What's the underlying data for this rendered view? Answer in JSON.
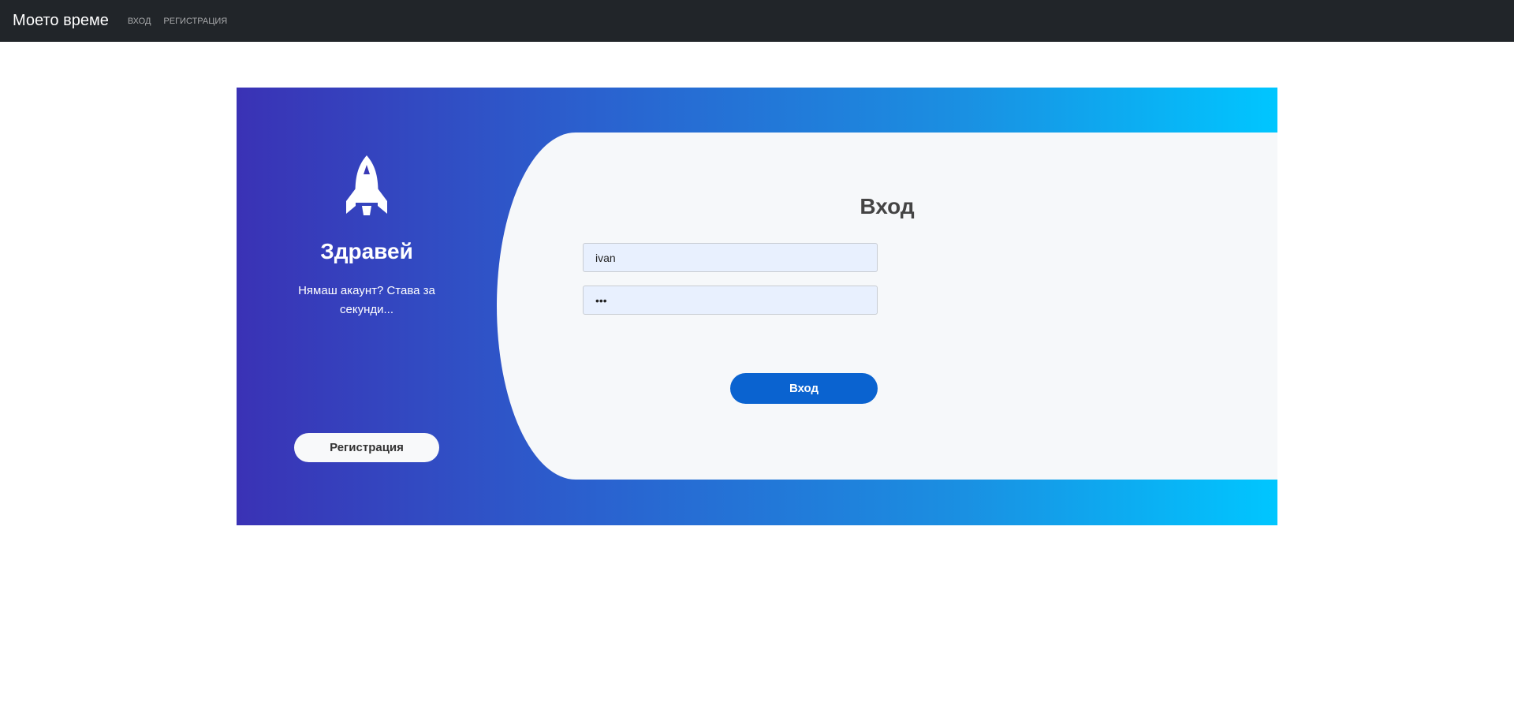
{
  "navbar": {
    "brand": "Моето време",
    "links": [
      "Вход",
      "Регистрация"
    ]
  },
  "left_panel": {
    "icon": "rocket-icon",
    "title": "Здравей",
    "subtitle": "Нямаш акаунт? Става за секунди...",
    "register_button": "Регистрация"
  },
  "login_form": {
    "title": "Вход",
    "username_value": "ivan",
    "password_value": "•••",
    "submit_button": "Вход"
  },
  "colors": {
    "navbar": "#212529",
    "gradient_start": "#3a32b5",
    "gradient_end": "#00c6ff",
    "primary_button": "#0a63d0"
  }
}
